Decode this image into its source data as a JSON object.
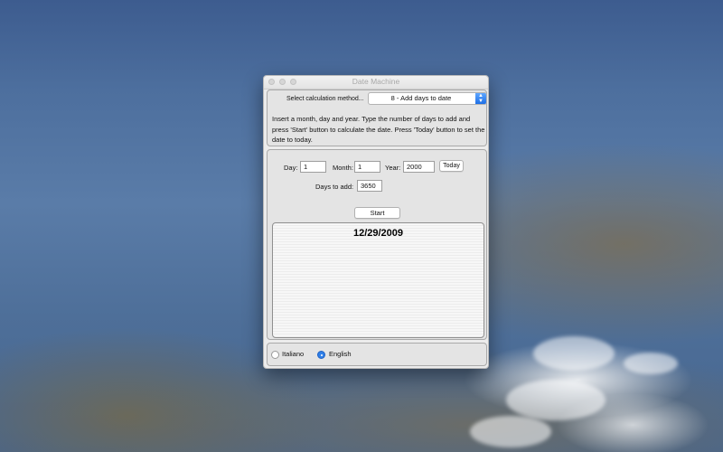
{
  "window": {
    "title": "Date Machine"
  },
  "method": {
    "label": "Select calculation method...",
    "selected": "8 - Add days to date"
  },
  "description": "Insert a month, day and year. Type the number of days to add and press 'Start' button to calculate the date. Press 'Today' button to set the date to today.",
  "inputs": {
    "day_label": "Day:",
    "day_value": "1",
    "month_label": "Month:",
    "month_value": "1",
    "year_label": "Year:",
    "year_value": "2000",
    "today_button": "Today",
    "days_label": "Days to add:",
    "days_value": "3650",
    "start_button": "Start"
  },
  "result": {
    "text": "12/29/2009"
  },
  "language": {
    "options": [
      {
        "label": "Italiano",
        "selected": false
      },
      {
        "label": "English",
        "selected": true
      }
    ]
  },
  "colors": {
    "accent": "#2f7fe8",
    "window_bg": "#ececec"
  }
}
